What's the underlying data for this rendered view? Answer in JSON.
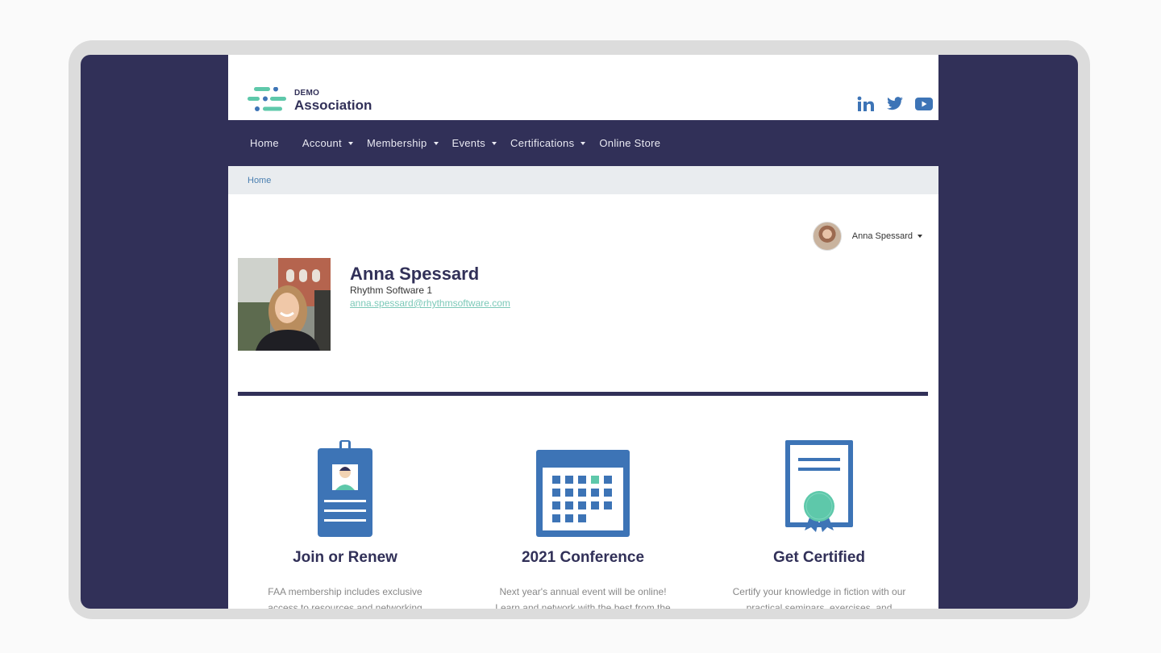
{
  "logo": {
    "top": "DEMO",
    "name": "Association"
  },
  "social": [
    {
      "name": "linkedin-icon"
    },
    {
      "name": "twitter-icon"
    },
    {
      "name": "youtube-icon"
    }
  ],
  "nav": {
    "items": [
      {
        "label": "Home",
        "dropdown": false
      },
      {
        "label": "Account",
        "dropdown": true
      },
      {
        "label": "Membership",
        "dropdown": true
      },
      {
        "label": "Events",
        "dropdown": true
      },
      {
        "label": "Certifications",
        "dropdown": true
      },
      {
        "label": "Online Store",
        "dropdown": false
      }
    ]
  },
  "breadcrumb": {
    "home": "Home"
  },
  "user_menu": {
    "name": "Anna Spessard"
  },
  "profile": {
    "name": "Anna Spessard",
    "company": "Rhythm Software 1",
    "email": "anna.spessard@rhythmsoftware.com"
  },
  "cards": [
    {
      "title": "Join or Renew",
      "desc_line1": "FAA membership includes exclusive",
      "desc_line2": "access to resources and networking"
    },
    {
      "title": "2021 Conference",
      "desc_line1": "Next year's annual event will be online!",
      "desc_line2": "Learn and network with the best from the"
    },
    {
      "title": "Get Certified",
      "desc_line1": "Certify your knowledge in fiction with our",
      "desc_line2": "practical seminars, exercises, and"
    }
  ],
  "colors": {
    "navy": "#313058",
    "blue": "#3d74b6",
    "teal": "#5ec8aa"
  }
}
